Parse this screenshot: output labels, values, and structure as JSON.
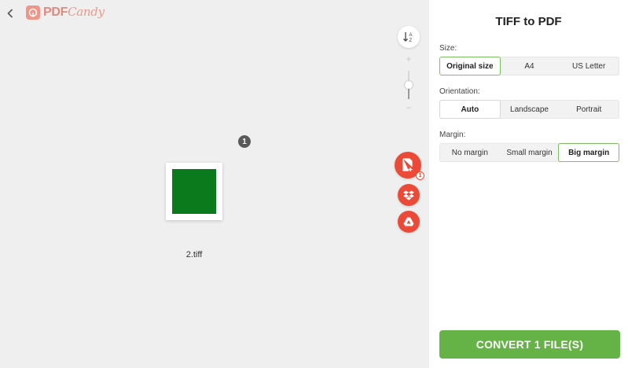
{
  "header": {
    "back_icon": "chevron-left-icon",
    "logo_pdf": "PDF",
    "logo_candy": "Candy"
  },
  "toolbar": {
    "sort_icon": "sort-az-icon",
    "zoom_level": 0.5
  },
  "files": {
    "count": "1",
    "items": [
      {
        "name": "2.tiff",
        "thumbnail_color": "#0a7a1c"
      }
    ]
  },
  "actions": {
    "add_file_badge": "1",
    "add_icon": "add-file-icon",
    "dropbox_icon": "dropbox-icon",
    "gdrive_icon": "google-drive-icon",
    "accent_color": "#ea4a37"
  },
  "panel": {
    "title": "TIFF to PDF",
    "size": {
      "label": "Size:",
      "options": [
        "Original size",
        "A4",
        "US Letter"
      ],
      "selected": "Original size"
    },
    "orientation": {
      "label": "Orientation:",
      "options": [
        "Auto",
        "Landscape",
        "Portrait"
      ],
      "selected": "Auto"
    },
    "margin": {
      "label": "Margin:",
      "options": [
        "No margin",
        "Small margin",
        "Big margin"
      ],
      "selected": "Big margin"
    },
    "convert_label": "CONVERT 1 FILE(S)",
    "convert_color": "#65b346"
  }
}
